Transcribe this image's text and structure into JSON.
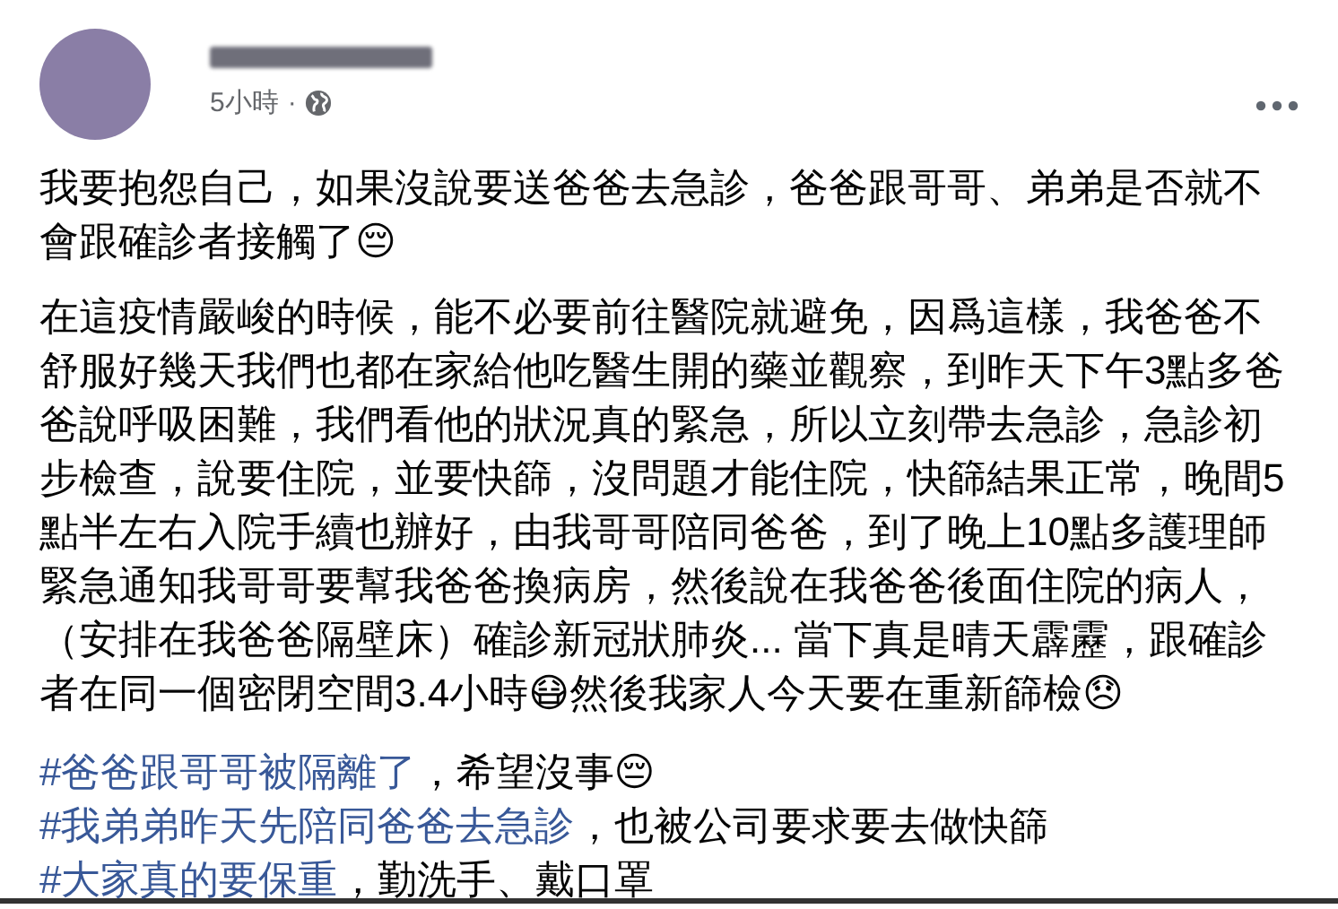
{
  "post": {
    "time": "5小時",
    "separator": "·",
    "paragraphs": [
      "我要抱怨自己，如果沒說要送爸爸去急診，爸爸跟哥哥、弟弟是否就不會跟確診者接觸了😔",
      "在這疫情嚴峻的時候，能不必要前往醫院就避免，因爲這樣，我爸爸不舒服好幾天我們也都在家給他吃醫生開的藥並觀察，到昨天下午3點多爸爸說呼吸困難，我們看他的狀況真的緊急，所以立刻帶去急診，急診初步檢查，說要住院，並要快篩，沒問題才能住院，快篩結果正常，晚間5點半左右入院手續也辦好，由我哥哥陪同爸爸，到了晚上10點多護理師緊急通知我哥哥要幫我爸爸換病房，然後說在我爸爸後面住院的病人，（安排在我爸爸隔壁床）確診新冠狀肺炎... 當下真是晴天霹靂，跟確診者在同一個密閉空間3.4小時😷然後我家人今天要在重新篩檢😞"
    ],
    "hashtag_lines": [
      {
        "tag": "#爸爸跟哥哥被隔離了",
        "text": "，希望沒事😔"
      },
      {
        "tag": "#我弟弟昨天先陪同爸爸去急診",
        "text": "，也被公司要求要去做快篩"
      },
      {
        "tag": "#大家真的要保重",
        "text": "，勤洗手、戴口罩"
      }
    ]
  }
}
